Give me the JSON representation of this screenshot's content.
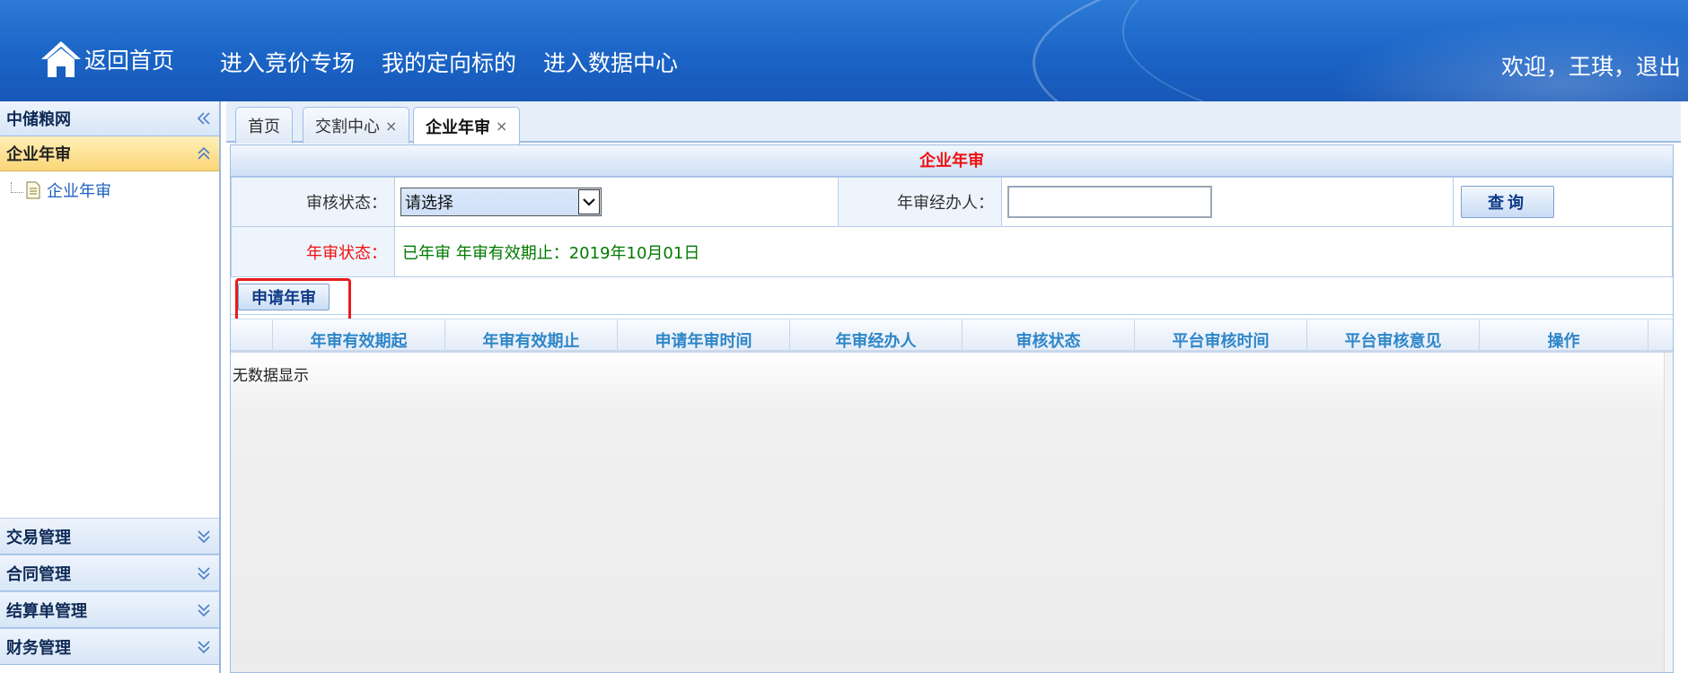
{
  "header": {
    "home_label": "返回首页",
    "nav": [
      "进入竞价专场",
      "我的定向标的",
      "进入数据中心"
    ],
    "welcome": "欢迎，王琪，退出"
  },
  "sidebar": {
    "top": "中储粮网",
    "active_section": "企业年审",
    "tree_item": "企业年审",
    "sections": [
      "交易管理",
      "合同管理",
      "结算单管理",
      "财务管理"
    ]
  },
  "tabs": [
    {
      "label": "首页",
      "closable": false
    },
    {
      "label": "交割中心",
      "closable": true
    },
    {
      "label": "企业年审",
      "closable": true
    }
  ],
  "tab_close_glyph": "×",
  "panel": {
    "title": "企业年审",
    "filter": {
      "status_label": "审核状态：",
      "status_value": "请选择",
      "agent_label": "年审经办人：",
      "agent_value": "",
      "query_label": "查询"
    },
    "annual_status_label": "年审状态：",
    "annual_status_value": "已年审 年审有效期止：2019年10月01日",
    "apply_button": "申请年审",
    "columns": [
      "年审有效期起",
      "年审有效期止",
      "申请年审时间",
      "年审经办人",
      "审核状态",
      "平台审核时间",
      "平台审核意见",
      "操作"
    ],
    "empty_text": "无数据显示"
  },
  "colors": {
    "header_blue": "#1b64c6",
    "title_red": "#ee1111",
    "status_green": "#007a00",
    "column_blue": "#2e86c8",
    "highlight_red": "#e51c1c"
  }
}
